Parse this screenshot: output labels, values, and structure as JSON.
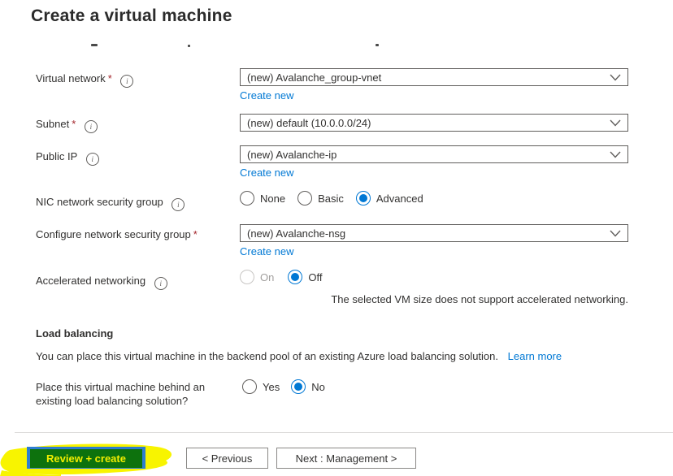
{
  "page": {
    "title": "Create a virtual machine"
  },
  "ui": {
    "required_marker": "*",
    "info_glyph": "i",
    "create_new_label": "Create new"
  },
  "form": {
    "rows": [
      {
        "label": "Virtual network",
        "required": true,
        "info": true,
        "type": "dropdown",
        "value": "(new) Avalanche_group-vnet",
        "create_new": "Create new"
      },
      {
        "label": "Subnet",
        "required": true,
        "info": true,
        "type": "dropdown",
        "value": "(new) default (10.0.0.0/24)"
      },
      {
        "label": "Public IP",
        "required": false,
        "info": true,
        "type": "dropdown",
        "value": "(new) Avalanche-ip",
        "create_new": "Create new"
      },
      {
        "label": "NIC network security group",
        "info": true,
        "type": "radio",
        "options": [
          "None",
          "Basic",
          "Advanced"
        ],
        "selected": "Advanced"
      },
      {
        "label": "Configure network security group",
        "required": true,
        "type": "dropdown",
        "value": "(new) Avalanche-nsg",
        "create_new": "Create new"
      },
      {
        "label": "Accelerated networking",
        "info": true,
        "type": "radio",
        "options": [
          "On",
          "Off"
        ],
        "selected": "Off",
        "disabled_options": [
          "On"
        ],
        "note": "The selected VM size does not support accelerated networking."
      }
    ]
  },
  "load_balancing": {
    "heading": "Load balancing",
    "description": "You can place this virtual machine in the backend pool of an existing Azure load balancing solution.",
    "learn_more": "Learn more",
    "question_line1": "Place this virtual machine behind an",
    "question_line2": "existing load balancing solution?",
    "options": [
      "Yes",
      "No"
    ],
    "selected": "No"
  },
  "footer": {
    "review_create": "Review + create",
    "previous": "< Previous",
    "next": "Next : Management >"
  },
  "icons": [
    "info-icon",
    "chevron-down-icon",
    "highlighter-annotation"
  ],
  "colors": {
    "accent_blue": "#0078d4",
    "text": "#323130",
    "required_red": "#a4262c",
    "field_border": "#605e5c",
    "highlight_yellow": "#f8f400",
    "annotated_button_green": "#0d720d",
    "annotated_button_blue": "#2e7dd1"
  }
}
